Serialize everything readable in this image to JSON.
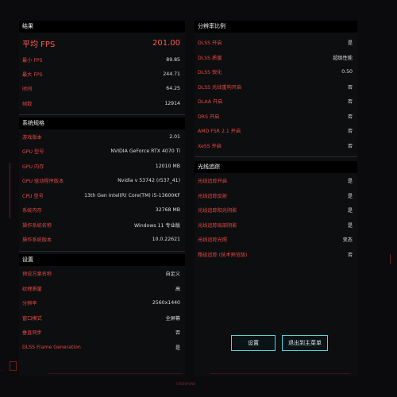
{
  "results": {
    "header": "结果",
    "avg_fps_label": "平均 FPS",
    "avg_fps_value": "201.00",
    "rows": [
      {
        "label": "最小 FPS",
        "value": "89.85"
      },
      {
        "label": "最大 FPS",
        "value": "244.71"
      },
      {
        "label": "时间",
        "value": "64.25"
      },
      {
        "label": "帧数",
        "value": "12914"
      }
    ]
  },
  "system": {
    "header": "系统规格",
    "rows": [
      {
        "label": "游戏版本",
        "value": "2.01"
      },
      {
        "label": "GPU 型号",
        "value": "NVIDIA GeForce RTX 4070 Ti"
      },
      {
        "label": "GPU 内存",
        "value": "12010 MB"
      },
      {
        "label": "GPU 驱动程序版本",
        "value": "Nvidia v 53742 (r537_41)"
      },
      {
        "label": "CPU 型号",
        "value": "13th Gen Intel(R) Core(TM) i5-13600KF"
      },
      {
        "label": "系统内存",
        "value": "32768 MB"
      },
      {
        "label": "操作系统名称",
        "value": "Windows 11 专业版"
      },
      {
        "label": "操作系统版本",
        "value": "10.0.22621"
      }
    ]
  },
  "settings": {
    "header": "设置",
    "rows": [
      {
        "label": "预设方案名称",
        "value": "自定义"
      },
      {
        "label": "纹理质量",
        "value": "高"
      },
      {
        "label": "分辨率",
        "value": "2560x1440"
      },
      {
        "label": "窗口模式",
        "value": "全屏幕"
      },
      {
        "label": "垂直同步",
        "value": "否"
      },
      {
        "label": "DLSS Frame Generation",
        "value": "是"
      }
    ]
  },
  "resolution_scaling": {
    "header": "分辨率比例",
    "rows": [
      {
        "label": "DLSS 开启",
        "value": "是"
      },
      {
        "label": "DLSS 质量",
        "value": "超级性能"
      },
      {
        "label": "DLSS 锐化",
        "value": "0.50"
      },
      {
        "label": "DLSS 光线重构开启",
        "value": "否"
      },
      {
        "label": "DLAA 开启",
        "value": "否"
      },
      {
        "label": "DRS 开启",
        "value": "否"
      },
      {
        "label": "AMD FSR 2.1 开启",
        "value": "否"
      },
      {
        "label": "XeSS 开启",
        "value": "否"
      }
    ]
  },
  "ray_tracing": {
    "header": "光线追踪",
    "rows": [
      {
        "label": "光线追踪开启",
        "value": "是"
      },
      {
        "label": "光线追踪反射",
        "value": "是"
      },
      {
        "label": "光线追踪阳光阴影",
        "value": "是"
      },
      {
        "label": "光线追踪局部阴影",
        "value": "是"
      },
      {
        "label": "光线追踪光照",
        "value": "变态"
      },
      {
        "label": "路径追踪 (技术预览版)",
        "value": "否"
      }
    ]
  },
  "buttons": {
    "settings_label": "设置",
    "exit_label": "退出到主菜单"
  },
  "footer": {
    "mark": "CYBERPUNK"
  },
  "colors": {
    "accent_red": "#e24a43",
    "value_white": "#dedede",
    "button_cyan": "#4fd4d8"
  }
}
